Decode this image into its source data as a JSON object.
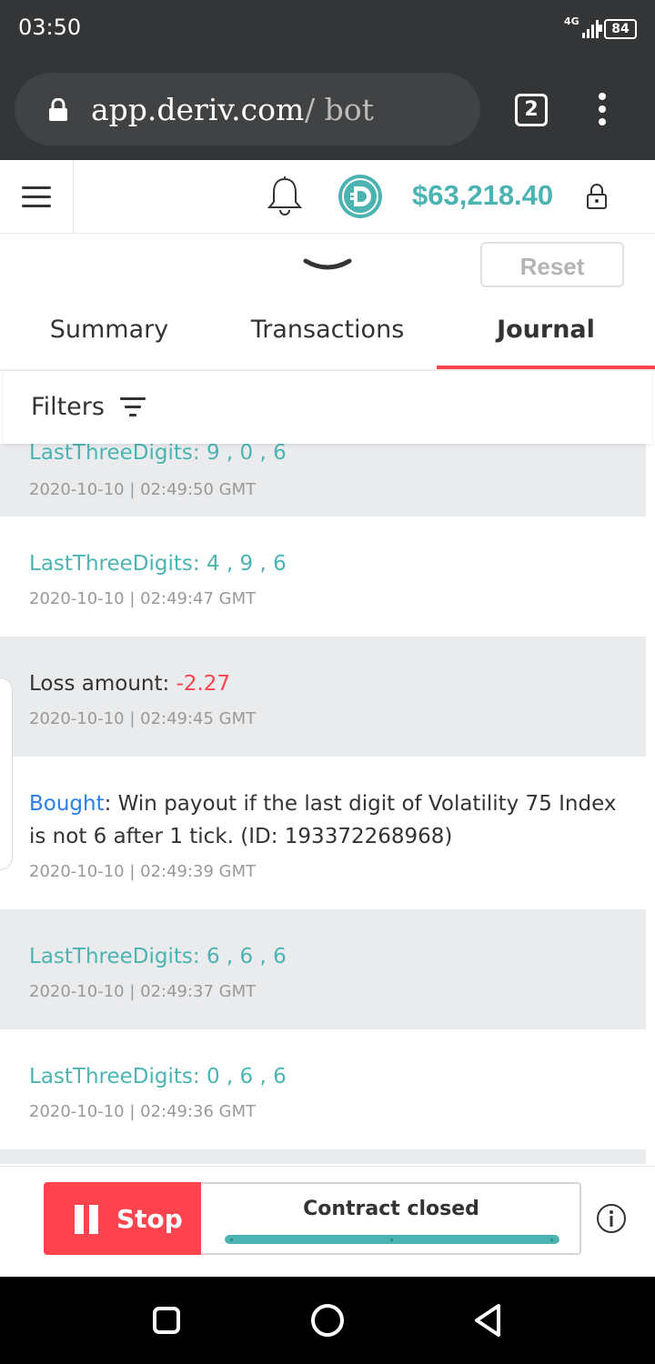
{
  "status_bar": {
    "time": "03:50",
    "network": "4G",
    "battery": "84"
  },
  "browser": {
    "url_domain": "app.deriv.com",
    "url_path": "/ bot",
    "tab_count": "2"
  },
  "header": {
    "balance": "$63,218.40"
  },
  "drawer": {
    "reset_label": "Reset"
  },
  "tabs": [
    {
      "label": "Summary"
    },
    {
      "label": "Transactions"
    },
    {
      "label": "Journal"
    }
  ],
  "filters": {
    "label": "Filters"
  },
  "journal": [
    {
      "kind": "digits",
      "prefix": "LastThreeDigits: ",
      "value": "9 , 0 , 6",
      "timestamp": "2020-10-10 | 02:49:50 GMT"
    },
    {
      "kind": "digits",
      "prefix": "LastThreeDigits: ",
      "value": "4 , 9 , 6",
      "timestamp": "2020-10-10 | 02:49:47 GMT"
    },
    {
      "kind": "loss",
      "prefix": "Loss amount: ",
      "value": "-2.27",
      "timestamp": "2020-10-10 | 02:49:45 GMT"
    },
    {
      "kind": "bought",
      "prefix": "Bought",
      "value": ": Win payout if the last digit of Volatility 75 Index is not 6 after 1 tick. (ID: 193372268968)",
      "timestamp": "2020-10-10 | 02:49:39 GMT"
    },
    {
      "kind": "digits",
      "prefix": "LastThreeDigits: ",
      "value": "6 , 6 , 6",
      "timestamp": "2020-10-10 | 02:49:37 GMT"
    },
    {
      "kind": "digits",
      "prefix": "LastThreeDigits: ",
      "value": "0 , 6 , 6",
      "timestamp": "2020-10-10 | 02:49:36 GMT"
    }
  ],
  "run_panel": {
    "stop_label": "Stop",
    "status": "Contract closed",
    "progress": 1.0
  },
  "colors": {
    "accent_teal": "#4bb4b3",
    "danger_red": "#ff444f",
    "link_blue": "#2a7fe6",
    "chrome_dark": "#333537"
  }
}
